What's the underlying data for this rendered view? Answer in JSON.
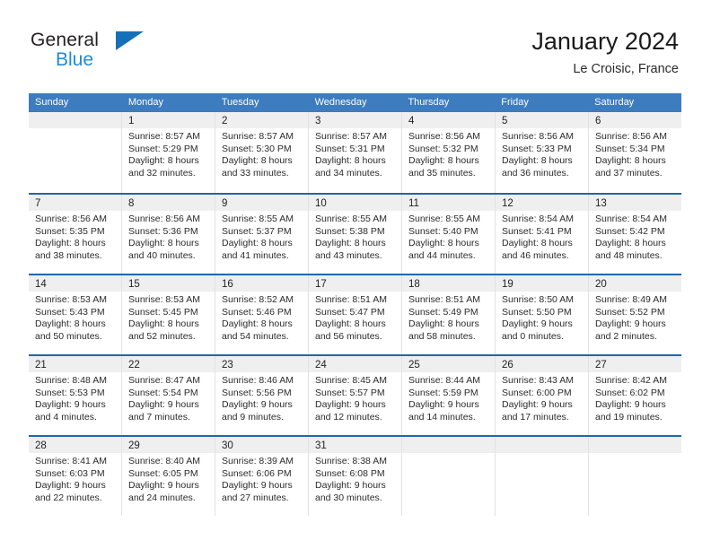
{
  "brand": {
    "line1": "General",
    "line2": "Blue",
    "triangle_icon": "brand-triangle-icon",
    "accent_color": "#1471b9",
    "blue_text_color": "#1f8ad6"
  },
  "header": {
    "title": "January 2024",
    "subtitle": "Le Croisic, France"
  },
  "colors": {
    "header_row_bg": "#3c7cbf",
    "week_divider": "#1f67ad",
    "daynum_strip_bg": "#efefef",
    "cell_border": "#e2e2e2",
    "text": "#2b2b2b"
  },
  "calendar": {
    "weekday_headers": [
      "Sunday",
      "Monday",
      "Tuesday",
      "Wednesday",
      "Thursday",
      "Friday",
      "Saturday"
    ],
    "weeks": [
      [
        {
          "day": "",
          "sunrise": "",
          "sunset": "",
          "daylight_1": "",
          "daylight_2": ""
        },
        {
          "day": "1",
          "sunrise": "Sunrise: 8:57 AM",
          "sunset": "Sunset: 5:29 PM",
          "daylight_1": "Daylight: 8 hours",
          "daylight_2": "and 32 minutes."
        },
        {
          "day": "2",
          "sunrise": "Sunrise: 8:57 AM",
          "sunset": "Sunset: 5:30 PM",
          "daylight_1": "Daylight: 8 hours",
          "daylight_2": "and 33 minutes."
        },
        {
          "day": "3",
          "sunrise": "Sunrise: 8:57 AM",
          "sunset": "Sunset: 5:31 PM",
          "daylight_1": "Daylight: 8 hours",
          "daylight_2": "and 34 minutes."
        },
        {
          "day": "4",
          "sunrise": "Sunrise: 8:56 AM",
          "sunset": "Sunset: 5:32 PM",
          "daylight_1": "Daylight: 8 hours",
          "daylight_2": "and 35 minutes."
        },
        {
          "day": "5",
          "sunrise": "Sunrise: 8:56 AM",
          "sunset": "Sunset: 5:33 PM",
          "daylight_1": "Daylight: 8 hours",
          "daylight_2": "and 36 minutes."
        },
        {
          "day": "6",
          "sunrise": "Sunrise: 8:56 AM",
          "sunset": "Sunset: 5:34 PM",
          "daylight_1": "Daylight: 8 hours",
          "daylight_2": "and 37 minutes."
        }
      ],
      [
        {
          "day": "7",
          "sunrise": "Sunrise: 8:56 AM",
          "sunset": "Sunset: 5:35 PM",
          "daylight_1": "Daylight: 8 hours",
          "daylight_2": "and 38 minutes."
        },
        {
          "day": "8",
          "sunrise": "Sunrise: 8:56 AM",
          "sunset": "Sunset: 5:36 PM",
          "daylight_1": "Daylight: 8 hours",
          "daylight_2": "and 40 minutes."
        },
        {
          "day": "9",
          "sunrise": "Sunrise: 8:55 AM",
          "sunset": "Sunset: 5:37 PM",
          "daylight_1": "Daylight: 8 hours",
          "daylight_2": "and 41 minutes."
        },
        {
          "day": "10",
          "sunrise": "Sunrise: 8:55 AM",
          "sunset": "Sunset: 5:38 PM",
          "daylight_1": "Daylight: 8 hours",
          "daylight_2": "and 43 minutes."
        },
        {
          "day": "11",
          "sunrise": "Sunrise: 8:55 AM",
          "sunset": "Sunset: 5:40 PM",
          "daylight_1": "Daylight: 8 hours",
          "daylight_2": "and 44 minutes."
        },
        {
          "day": "12",
          "sunrise": "Sunrise: 8:54 AM",
          "sunset": "Sunset: 5:41 PM",
          "daylight_1": "Daylight: 8 hours",
          "daylight_2": "and 46 minutes."
        },
        {
          "day": "13",
          "sunrise": "Sunrise: 8:54 AM",
          "sunset": "Sunset: 5:42 PM",
          "daylight_1": "Daylight: 8 hours",
          "daylight_2": "and 48 minutes."
        }
      ],
      [
        {
          "day": "14",
          "sunrise": "Sunrise: 8:53 AM",
          "sunset": "Sunset: 5:43 PM",
          "daylight_1": "Daylight: 8 hours",
          "daylight_2": "and 50 minutes."
        },
        {
          "day": "15",
          "sunrise": "Sunrise: 8:53 AM",
          "sunset": "Sunset: 5:45 PM",
          "daylight_1": "Daylight: 8 hours",
          "daylight_2": "and 52 minutes."
        },
        {
          "day": "16",
          "sunrise": "Sunrise: 8:52 AM",
          "sunset": "Sunset: 5:46 PM",
          "daylight_1": "Daylight: 8 hours",
          "daylight_2": "and 54 minutes."
        },
        {
          "day": "17",
          "sunrise": "Sunrise: 8:51 AM",
          "sunset": "Sunset: 5:47 PM",
          "daylight_1": "Daylight: 8 hours",
          "daylight_2": "and 56 minutes."
        },
        {
          "day": "18",
          "sunrise": "Sunrise: 8:51 AM",
          "sunset": "Sunset: 5:49 PM",
          "daylight_1": "Daylight: 8 hours",
          "daylight_2": "and 58 minutes."
        },
        {
          "day": "19",
          "sunrise": "Sunrise: 8:50 AM",
          "sunset": "Sunset: 5:50 PM",
          "daylight_1": "Daylight: 9 hours",
          "daylight_2": "and 0 minutes."
        },
        {
          "day": "20",
          "sunrise": "Sunrise: 8:49 AM",
          "sunset": "Sunset: 5:52 PM",
          "daylight_1": "Daylight: 9 hours",
          "daylight_2": "and 2 minutes."
        }
      ],
      [
        {
          "day": "21",
          "sunrise": "Sunrise: 8:48 AM",
          "sunset": "Sunset: 5:53 PM",
          "daylight_1": "Daylight: 9 hours",
          "daylight_2": "and 4 minutes."
        },
        {
          "day": "22",
          "sunrise": "Sunrise: 8:47 AM",
          "sunset": "Sunset: 5:54 PM",
          "daylight_1": "Daylight: 9 hours",
          "daylight_2": "and 7 minutes."
        },
        {
          "day": "23",
          "sunrise": "Sunrise: 8:46 AM",
          "sunset": "Sunset: 5:56 PM",
          "daylight_1": "Daylight: 9 hours",
          "daylight_2": "and 9 minutes."
        },
        {
          "day": "24",
          "sunrise": "Sunrise: 8:45 AM",
          "sunset": "Sunset: 5:57 PM",
          "daylight_1": "Daylight: 9 hours",
          "daylight_2": "and 12 minutes."
        },
        {
          "day": "25",
          "sunrise": "Sunrise: 8:44 AM",
          "sunset": "Sunset: 5:59 PM",
          "daylight_1": "Daylight: 9 hours",
          "daylight_2": "and 14 minutes."
        },
        {
          "day": "26",
          "sunrise": "Sunrise: 8:43 AM",
          "sunset": "Sunset: 6:00 PM",
          "daylight_1": "Daylight: 9 hours",
          "daylight_2": "and 17 minutes."
        },
        {
          "day": "27",
          "sunrise": "Sunrise: 8:42 AM",
          "sunset": "Sunset: 6:02 PM",
          "daylight_1": "Daylight: 9 hours",
          "daylight_2": "and 19 minutes."
        }
      ],
      [
        {
          "day": "28",
          "sunrise": "Sunrise: 8:41 AM",
          "sunset": "Sunset: 6:03 PM",
          "daylight_1": "Daylight: 9 hours",
          "daylight_2": "and 22 minutes."
        },
        {
          "day": "29",
          "sunrise": "Sunrise: 8:40 AM",
          "sunset": "Sunset: 6:05 PM",
          "daylight_1": "Daylight: 9 hours",
          "daylight_2": "and 24 minutes."
        },
        {
          "day": "30",
          "sunrise": "Sunrise: 8:39 AM",
          "sunset": "Sunset: 6:06 PM",
          "daylight_1": "Daylight: 9 hours",
          "daylight_2": "and 27 minutes."
        },
        {
          "day": "31",
          "sunrise": "Sunrise: 8:38 AM",
          "sunset": "Sunset: 6:08 PM",
          "daylight_1": "Daylight: 9 hours",
          "daylight_2": "and 30 minutes."
        },
        {
          "day": "",
          "sunrise": "",
          "sunset": "",
          "daylight_1": "",
          "daylight_2": ""
        },
        {
          "day": "",
          "sunrise": "",
          "sunset": "",
          "daylight_1": "",
          "daylight_2": ""
        },
        {
          "day": "",
          "sunrise": "",
          "sunset": "",
          "daylight_1": "",
          "daylight_2": ""
        }
      ]
    ]
  }
}
